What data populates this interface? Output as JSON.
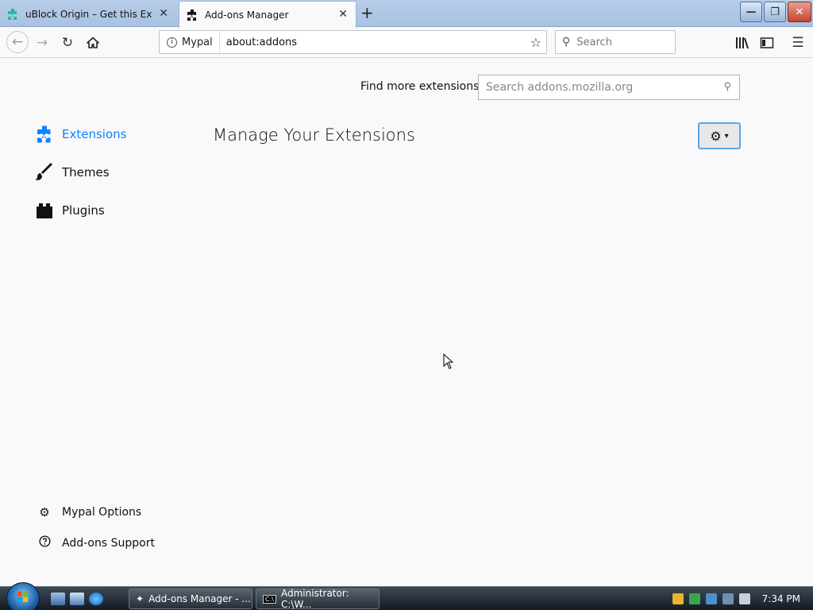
{
  "browser": {
    "tabs": [
      {
        "title": "uBlock Origin – Get this Extension",
        "active": false,
        "icon": "ublock-puzzle-icon"
      },
      {
        "title": "Add-ons Manager",
        "active": true,
        "icon": "puzzle-icon"
      }
    ],
    "new_tab_label": "+",
    "identity_label": "Mypal",
    "url": "about:addons",
    "search_placeholder": "Search"
  },
  "addons": {
    "find_more_label": "Find more extensions",
    "amo_search_placeholder": "Search addons.mozilla.org",
    "heading": "Manage Your Extensions",
    "categories": [
      {
        "label": "Extensions",
        "icon": "puzzle-icon",
        "selected": true
      },
      {
        "label": "Themes",
        "icon": "brush-icon",
        "selected": false
      },
      {
        "label": "Plugins",
        "icon": "plugin-block-icon",
        "selected": false
      }
    ],
    "footer": [
      {
        "label": "Mypal Options",
        "icon": "gear-icon"
      },
      {
        "label": "Add-ons Support",
        "icon": "help-circle-icon"
      }
    ]
  },
  "taskbar": {
    "items": [
      {
        "label": "Add-ons Manager - ...",
        "icon": "mypal-icon"
      },
      {
        "label": "Administrator: C:\\W...",
        "icon": "cmd-icon"
      }
    ],
    "clock": "7:34 PM"
  },
  "colors": {
    "accent": "#0a84ff",
    "selected_category": "#0a84ff"
  }
}
